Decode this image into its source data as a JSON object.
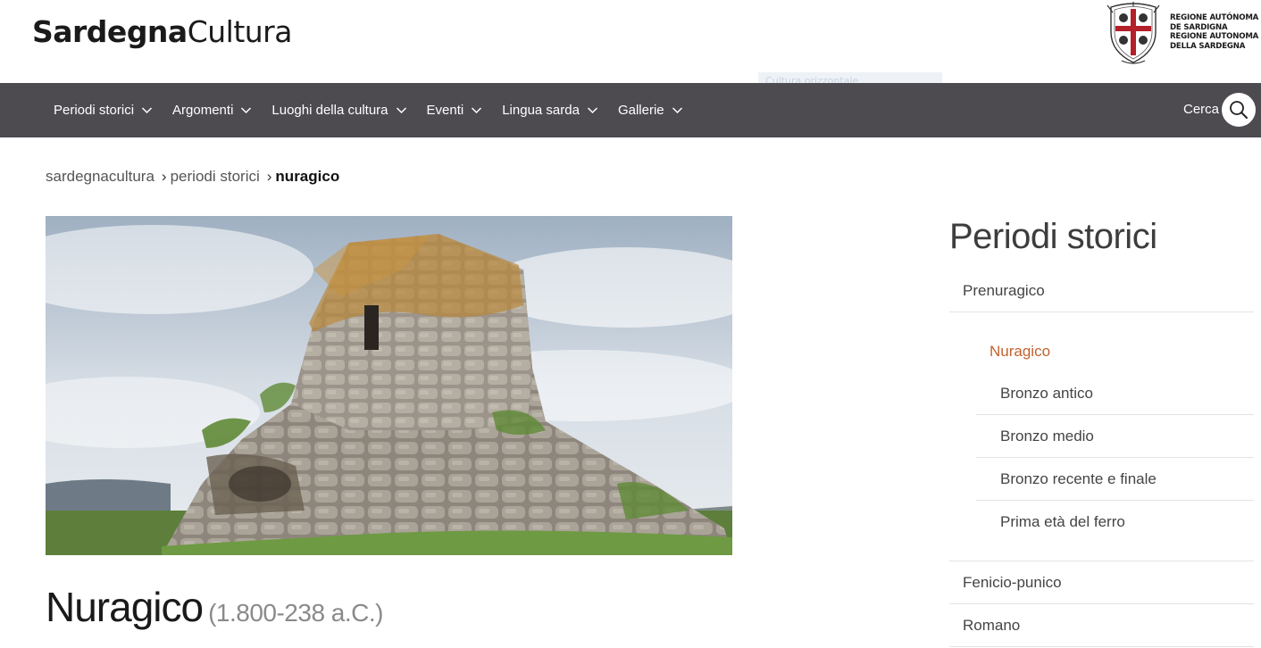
{
  "header": {
    "logo_bold": "Sardegna",
    "logo_light": "Cultura",
    "region_lines": [
      "REGIONE AUTÓNOMA",
      "DE SARDIGNA",
      "REGIONE AUTONOMA",
      "DELLA SARDEGNA"
    ],
    "ghost_text": "Cultura orizzontale"
  },
  "nav": {
    "items": [
      {
        "label": "Periodi storici"
      },
      {
        "label": "Argomenti"
      },
      {
        "label": "Luoghi della cultura"
      },
      {
        "label": "Eventi"
      },
      {
        "label": "Lingua sarda"
      },
      {
        "label": "Gallerie"
      }
    ],
    "search_label": "Cerca"
  },
  "breadcrumb": {
    "items": [
      "sardegnacultura",
      "periodi storici",
      "nuragico"
    ],
    "separator": "›"
  },
  "main": {
    "title": "Nuragico",
    "date_range": "(1.800-238 a.C.)"
  },
  "sidebar": {
    "title": "Periodi storici",
    "items": [
      {
        "label": "Prenuragico"
      },
      {
        "label": "Nuragico"
      },
      {
        "label": "Bronzo antico"
      },
      {
        "label": "Bronzo medio"
      },
      {
        "label": "Bronzo recente e finale"
      },
      {
        "label": "Prima età del ferro"
      },
      {
        "label": "Fenicio-punico"
      },
      {
        "label": "Romano"
      }
    ]
  },
  "colors": {
    "nav_bg": "#4d4a50",
    "active": "#c0622e",
    "seal_cross": "#b3202a"
  },
  "icons": [
    "chevron-down-icon",
    "search-icon",
    "region-seal-icon"
  ]
}
